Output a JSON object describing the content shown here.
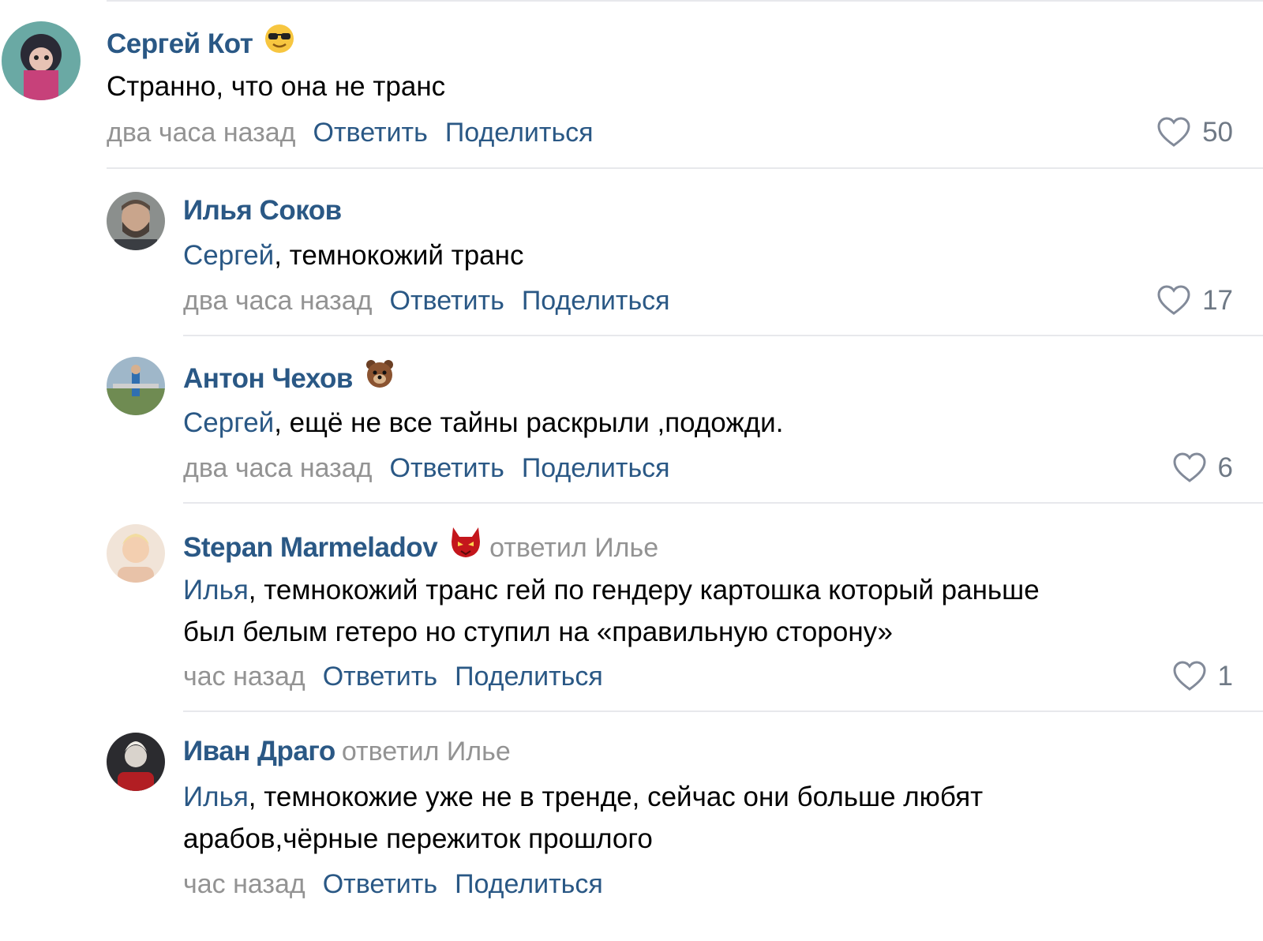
{
  "comments": [
    {
      "author": "Сергей Кот",
      "emoji": "cool-sunglasses-emoji",
      "mention": "",
      "text": "Странно, что она не транс",
      "time": "два часа назад",
      "reply_label": "Ответить",
      "share_label": "Поделиться",
      "likes": "50"
    },
    {
      "author": "Илья Соков",
      "mention": "Сергей",
      "text": ", темнокожий транс",
      "time": "два часа назад",
      "reply_label": "Ответить",
      "share_label": "Поделиться",
      "likes": "17"
    },
    {
      "author": "Антон Чехов",
      "emoji": "bear-emoji",
      "mention": "Сергей",
      "text": ", ещё не все тайны раскрыли ,подожди.",
      "time": "два часа назад",
      "reply_label": "Ответить",
      "share_label": "Поделиться",
      "likes": "6"
    },
    {
      "author": "Stepan Marmeladov",
      "emoji": "red-devil-emoji",
      "replied_to": "ответил Илье",
      "mention": "Илья",
      "text_line1": ", темнокожий транс гей по гендеру картошка который раньше",
      "text_line2": "был белым гетеро но ступил на «правильную сторону»",
      "time": "час назад",
      "reply_label": "Ответить",
      "share_label": "Поделиться",
      "likes": "1"
    },
    {
      "author": "Иван Драго",
      "replied_to": "ответил Илье",
      "mention": "Илья",
      "text_line1": ", темнокожие уже не в тренде, сейчас они больше любят",
      "text_line2": "арабов,чёрные пережиток прошлого",
      "time": "час назад",
      "reply_label": "Ответить",
      "share_label": "Поделиться"
    }
  ],
  "colors": {
    "link": "#2a5885",
    "muted": "#939393",
    "divider": "#e7e8ec"
  }
}
